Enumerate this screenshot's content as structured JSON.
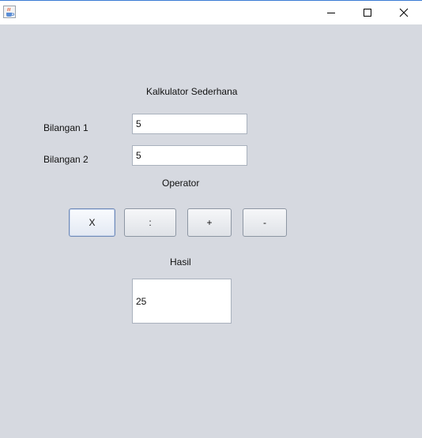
{
  "window": {
    "icon": "java-cup-icon",
    "controls": [
      "minimize-icon",
      "maximize-icon",
      "close-icon"
    ]
  },
  "form": {
    "title": "Kalkulator Sederhana",
    "bilangan1_label": "Bilangan 1",
    "bilangan1_value": "5",
    "bilangan2_label": "Bilangan 2",
    "bilangan2_value": "5",
    "operator_label": "Operator",
    "operators": {
      "multiply": "X",
      "divide": ":",
      "add": "+",
      "subtract": "-"
    },
    "hasil_label": "Hasil",
    "hasil_value": "25"
  },
  "colors": {
    "background": "#d6d9e0",
    "titlebar": "#ffffff",
    "field_border": "#a9b1bd",
    "button_border": "#8d96a3",
    "focused_border": "#6f8ab8"
  }
}
